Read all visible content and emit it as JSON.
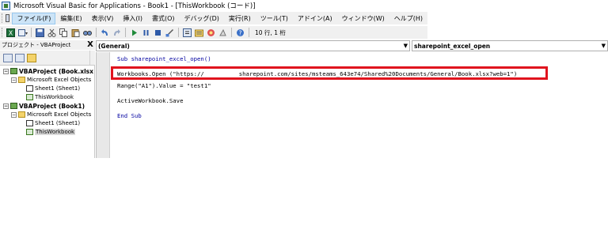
{
  "window": {
    "title": "Microsoft Visual Basic for Applications - Book1 - [ThisWorkbook (コード)]"
  },
  "menubar": {
    "items": [
      "ファイル(F)",
      "編集(E)",
      "表示(V)",
      "挿入(I)",
      "書式(O)",
      "デバッグ(D)",
      "実行(R)",
      "ツール(T)",
      "アドイン(A)",
      "ウィンドウ(W)",
      "ヘルプ(H)"
    ]
  },
  "toolbar": {
    "status": "10 行, 1 桁",
    "icons": [
      "excel-icon",
      "insert-module-icon",
      "save-icon",
      "cut-icon",
      "copy-icon",
      "paste-icon",
      "find-icon",
      "undo-icon",
      "redo-icon",
      "run-icon",
      "break-icon",
      "reset-icon",
      "design-mode-icon",
      "project-explorer-icon",
      "properties-icon",
      "object-browser-icon",
      "toolbox-icon",
      "help-icon"
    ]
  },
  "project_panel": {
    "title": "プロジェクト - VBAProject",
    "close": "X",
    "tree": [
      {
        "label": "VBAProject (Book.xlsx",
        "level": 0,
        "bold": true,
        "icon": "project-icon",
        "expander": "−"
      },
      {
        "label": "Microsoft Excel Objects",
        "level": 1,
        "bold": false,
        "icon": "folder-icon",
        "expander": "−"
      },
      {
        "label": "Sheet1 (Sheet1)",
        "level": 2,
        "bold": false,
        "icon": "sheet-icon",
        "expander": ""
      },
      {
        "label": "ThisWorkbook",
        "level": 2,
        "bold": false,
        "icon": "workbook-icon",
        "expander": ""
      },
      {
        "label": "VBAProject (Book1)",
        "level": 0,
        "bold": true,
        "icon": "project-icon",
        "expander": "−"
      },
      {
        "label": "Microsoft Excel Objects",
        "level": 1,
        "bold": false,
        "icon": "folder-icon",
        "expander": "−"
      },
      {
        "label": "Sheet1 (Sheet1)",
        "level": 2,
        "bold": false,
        "icon": "sheet-icon",
        "expander": ""
      },
      {
        "label": "ThisWorkbook",
        "level": 2,
        "bold": false,
        "icon": "workbook-icon",
        "expander": "",
        "selected": true
      }
    ]
  },
  "code_window": {
    "object_dropdown": "(General)",
    "procedure_dropdown": "sharepoint_excel_open",
    "lines": [
      "Sub sharepoint_excel_open()",
      "Workbooks.Open (\"https://          sharepoint.com/sites/msteams_643e74/Shared%20Documents/General/Book.xlsx?web=1\")",
      "Range(\"A1\").Value = \"test1\"",
      "ActiveWorkbook.Save",
      "End Sub"
    ]
  },
  "colors": {
    "highlight_border": "#e0141e",
    "keyword": "#0000a0",
    "menu_active": "#cce4f7"
  }
}
